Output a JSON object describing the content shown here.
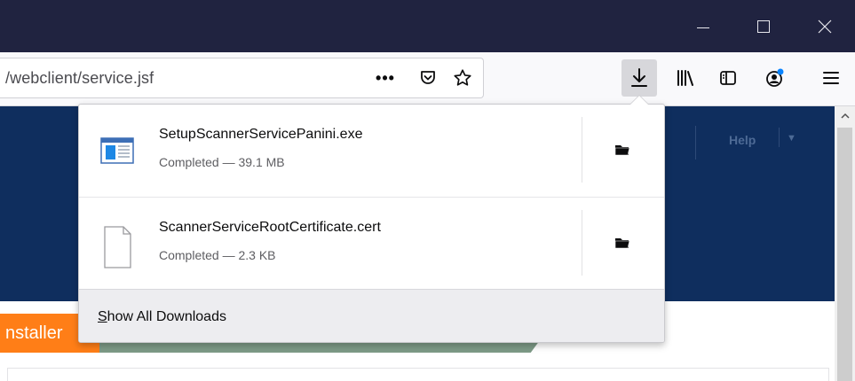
{
  "titlebar": {
    "bg_color": "#202340",
    "controls": [
      "minimize",
      "maximize",
      "close"
    ]
  },
  "toolbar": {
    "url_text": "/webclient/service.jsf",
    "page_actions_label": "•••",
    "icons": [
      "pocket-icon",
      "bookmark-star-icon",
      "download-icon",
      "library-icon",
      "sidebar-icon",
      "account-icon",
      "hamburger-menu-icon"
    ]
  },
  "page": {
    "header_color": "#0f2e5e",
    "help_label": "Help",
    "help_caret": "▼",
    "installer_label": "nstaller",
    "installer_color": "#ff7e17"
  },
  "downloads": {
    "items": [
      {
        "name": "SetupScannerServicePanini.exe",
        "status": "Completed — 39.1 MB",
        "icon": "exe-file-icon"
      },
      {
        "name": "ScannerServiceRootCertificate.cert",
        "status": "Completed — 2.3 KB",
        "icon": "generic-file-icon"
      }
    ],
    "footer_label_first": "S",
    "footer_label_rest": "how All Downloads"
  }
}
